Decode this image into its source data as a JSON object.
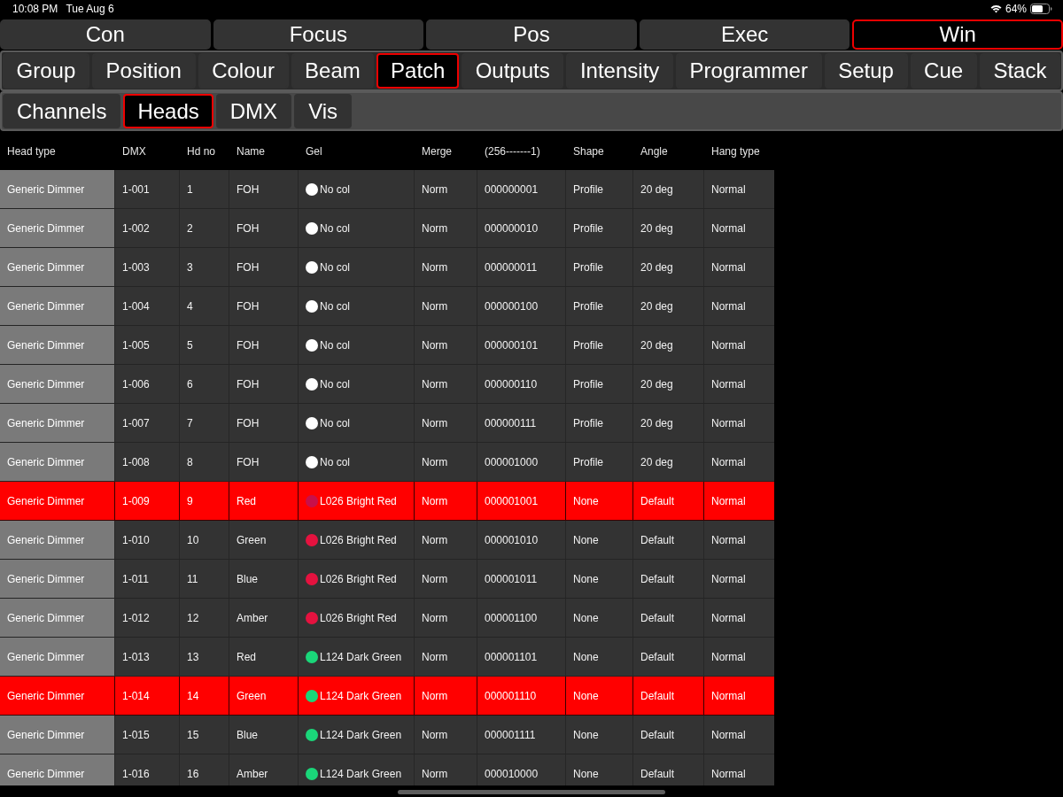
{
  "status_bar": {
    "time": "10:08 PM",
    "date": "Tue Aug 6",
    "battery": "64%"
  },
  "main_tabs": [
    {
      "label": "Con",
      "selected": false
    },
    {
      "label": "Focus",
      "selected": false
    },
    {
      "label": "Pos",
      "selected": false
    },
    {
      "label": "Exec",
      "selected": false
    },
    {
      "label": "Win",
      "selected": true
    }
  ],
  "section_tabs": [
    {
      "label": "Group",
      "selected": false
    },
    {
      "label": "Position",
      "selected": false
    },
    {
      "label": "Colour",
      "selected": false
    },
    {
      "label": "Beam",
      "selected": false
    },
    {
      "label": "Patch",
      "selected": true
    },
    {
      "label": "Outputs",
      "selected": false
    },
    {
      "label": "Intensity",
      "selected": false
    },
    {
      "label": "Programmer",
      "selected": false
    },
    {
      "label": "Setup",
      "selected": false
    },
    {
      "label": "Cue",
      "selected": false
    },
    {
      "label": "Stack",
      "selected": false
    }
  ],
  "sub_tabs": [
    {
      "label": "Channels",
      "selected": false
    },
    {
      "label": "Heads",
      "selected": true
    },
    {
      "label": "DMX",
      "selected": false
    },
    {
      "label": "Vis",
      "selected": false
    }
  ],
  "table": {
    "columns": [
      "Head type",
      "DMX",
      "Hd no",
      "Name",
      "Gel",
      "Merge",
      "(256-------1)",
      "Shape",
      "Angle",
      "Hang type"
    ],
    "rows": [
      {
        "selected": false,
        "head_type": "Generic Dimmer",
        "dmx": "1-001",
        "hd_no": "1",
        "name": "FOH",
        "gel": {
          "label": "No col",
          "color": "#ffffff"
        },
        "merge": "Norm",
        "binary": "000000001",
        "shape": "Profile",
        "angle": "20 deg",
        "hang_type": "Normal"
      },
      {
        "selected": false,
        "head_type": "Generic Dimmer",
        "dmx": "1-002",
        "hd_no": "2",
        "name": "FOH",
        "gel": {
          "label": "No col",
          "color": "#ffffff"
        },
        "merge": "Norm",
        "binary": "000000010",
        "shape": "Profile",
        "angle": "20 deg",
        "hang_type": "Normal"
      },
      {
        "selected": false,
        "head_type": "Generic Dimmer",
        "dmx": "1-003",
        "hd_no": "3",
        "name": "FOH",
        "gel": {
          "label": "No col",
          "color": "#ffffff"
        },
        "merge": "Norm",
        "binary": "000000011",
        "shape": "Profile",
        "angle": "20 deg",
        "hang_type": "Normal"
      },
      {
        "selected": false,
        "head_type": "Generic Dimmer",
        "dmx": "1-004",
        "hd_no": "4",
        "name": "FOH",
        "gel": {
          "label": "No col",
          "color": "#ffffff"
        },
        "merge": "Norm",
        "binary": "000000100",
        "shape": "Profile",
        "angle": "20 deg",
        "hang_type": "Normal"
      },
      {
        "selected": false,
        "head_type": "Generic Dimmer",
        "dmx": "1-005",
        "hd_no": "5",
        "name": "FOH",
        "gel": {
          "label": "No col",
          "color": "#ffffff"
        },
        "merge": "Norm",
        "binary": "000000101",
        "shape": "Profile",
        "angle": "20 deg",
        "hang_type": "Normal"
      },
      {
        "selected": false,
        "head_type": "Generic Dimmer",
        "dmx": "1-006",
        "hd_no": "6",
        "name": "FOH",
        "gel": {
          "label": "No col",
          "color": "#ffffff"
        },
        "merge": "Norm",
        "binary": "000000110",
        "shape": "Profile",
        "angle": "20 deg",
        "hang_type": "Normal"
      },
      {
        "selected": false,
        "head_type": "Generic Dimmer",
        "dmx": "1-007",
        "hd_no": "7",
        "name": "FOH",
        "gel": {
          "label": "No col",
          "color": "#ffffff"
        },
        "merge": "Norm",
        "binary": "000000111",
        "shape": "Profile",
        "angle": "20 deg",
        "hang_type": "Normal"
      },
      {
        "selected": false,
        "head_type": "Generic Dimmer",
        "dmx": "1-008",
        "hd_no": "8",
        "name": "FOH",
        "gel": {
          "label": "No col",
          "color": "#ffffff"
        },
        "merge": "Norm",
        "binary": "000001000",
        "shape": "Profile",
        "angle": "20 deg",
        "hang_type": "Normal"
      },
      {
        "selected": true,
        "head_type": "Generic Dimmer",
        "dmx": "1-009",
        "hd_no": "9",
        "name": "Red",
        "gel": {
          "label": "L026 Bright Red",
          "color": "#c8104a"
        },
        "merge": "Norm",
        "binary": "000001001",
        "shape": "None",
        "angle": "Default",
        "hang_type": "Normal"
      },
      {
        "selected": false,
        "head_type": "Generic Dimmer",
        "dmx": "1-010",
        "hd_no": "10",
        "name": "Green",
        "gel": {
          "label": "L026 Bright Red",
          "color": "#e5123f"
        },
        "merge": "Norm",
        "binary": "000001010",
        "shape": "None",
        "angle": "Default",
        "hang_type": "Normal"
      },
      {
        "selected": false,
        "head_type": "Generic Dimmer",
        "dmx": "1-011",
        "hd_no": "11",
        "name": "Blue",
        "gel": {
          "label": "L026 Bright Red",
          "color": "#e5123f"
        },
        "merge": "Norm",
        "binary": "000001011",
        "shape": "None",
        "angle": "Default",
        "hang_type": "Normal"
      },
      {
        "selected": false,
        "head_type": "Generic Dimmer",
        "dmx": "1-012",
        "hd_no": "12",
        "name": "Amber",
        "gel": {
          "label": "L026 Bright Red",
          "color": "#e5123f"
        },
        "merge": "Norm",
        "binary": "000001100",
        "shape": "None",
        "angle": "Default",
        "hang_type": "Normal"
      },
      {
        "selected": false,
        "head_type": "Generic Dimmer",
        "dmx": "1-013",
        "hd_no": "13",
        "name": "Red",
        "gel": {
          "label": "L124 Dark Green",
          "color": "#1ad679"
        },
        "merge": "Norm",
        "binary": "000001101",
        "shape": "None",
        "angle": "Default",
        "hang_type": "Normal"
      },
      {
        "selected": true,
        "head_type": "Generic Dimmer",
        "dmx": "1-014",
        "hd_no": "14",
        "name": "Green",
        "gel": {
          "label": "L124 Dark Green",
          "color": "#1ad679"
        },
        "merge": "Norm",
        "binary": "000001110",
        "shape": "None",
        "angle": "Default",
        "hang_type": "Normal"
      },
      {
        "selected": false,
        "head_type": "Generic Dimmer",
        "dmx": "1-015",
        "hd_no": "15",
        "name": "Blue",
        "gel": {
          "label": "L124 Dark Green",
          "color": "#1ad679"
        },
        "merge": "Norm",
        "binary": "000001111",
        "shape": "None",
        "angle": "Default",
        "hang_type": "Normal"
      },
      {
        "selected": false,
        "head_type": "Generic Dimmer",
        "dmx": "1-016",
        "hd_no": "16",
        "name": "Amber",
        "gel": {
          "label": "L124 Dark Green",
          "color": "#1ad679"
        },
        "merge": "Norm",
        "binary": "000010000",
        "shape": "None",
        "angle": "Default",
        "hang_type": "Normal"
      }
    ]
  }
}
